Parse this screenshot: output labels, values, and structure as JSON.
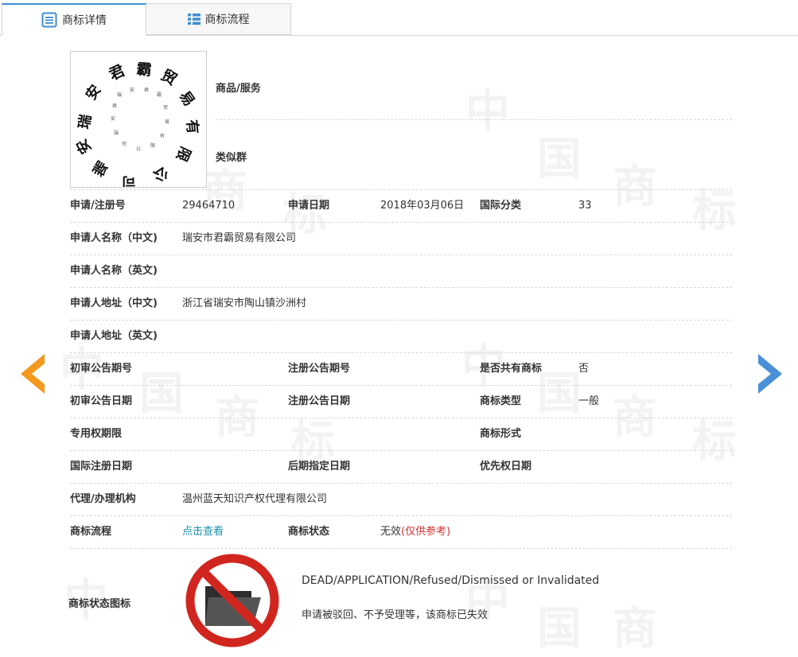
{
  "tabs": [
    {
      "label": "商标详情",
      "active": true,
      "icon": "document-list-icon"
    },
    {
      "label": "商标流程",
      "active": false,
      "icon": "grid-list-icon"
    }
  ],
  "watermark": {
    "chars": [
      "中",
      "国",
      "商",
      "标"
    ]
  },
  "logo": {
    "description_icon": "calligraphy-circular-logo",
    "chars_outer": [
      "端",
      "安",
      "君",
      "霸",
      "贸",
      "易",
      "有",
      "限",
      "公",
      "司",
      "瑞"
    ]
  },
  "goods_services_label": "商品/服务",
  "similar_group_label": "类似群",
  "fields": {
    "reg_no_label": "申请/注册号",
    "reg_no_value": "29464710",
    "app_date_label": "申请日期",
    "app_date_value": "2018年03月06日",
    "intl_class_label": "国际分类",
    "intl_class_value": "33",
    "applicant_cn_label": "申请人名称（中文)",
    "applicant_cn_value": "瑞安市君霸贸易有限公司",
    "applicant_en_label": "申请人名称（英文)",
    "address_cn_label": "申请人地址（中文)",
    "address_cn_value": "浙江省瑞安市陶山镇沙洲村",
    "address_en_label": "申请人地址（英文)",
    "prelim_no_label": "初审公告期号",
    "reg_notice_no_label": "注册公告期号",
    "shared_label": "是否共有商标",
    "shared_value": "否",
    "prelim_date_label": "初审公告日期",
    "reg_notice_date_label": "注册公告日期",
    "type_label": "商标类型",
    "type_value": "一般",
    "exclusive_term_label": "专用权期限",
    "form_label": "商标形式",
    "intl_reg_date_label": "国际注册日期",
    "later_designation_label": "后期指定日期",
    "priority_date_label": "优先权日期",
    "agent_label": "代理/办理机构",
    "agent_value": "温州蓝天知识产权代理有限公司",
    "process_label": "商标流程",
    "process_link": "点击查看",
    "status_label": "商标状态",
    "status_value": "无效",
    "status_ref": "(仅供参考)",
    "status_icon_label": "商标状态图标",
    "status_en": "DEAD/APPLICATION/Refused/Dismissed or Invalidated",
    "status_zh": "申请被驳回、不予受理等，该商标已失效"
  },
  "nav": {
    "prev_icon": "chevron-left-icon",
    "next_icon": "chevron-right-icon"
  },
  "colors": {
    "accent": "#3e8ed0",
    "prev_arrow": "#f39a1e",
    "next_arrow": "#4a90d9",
    "link": "#1a8fb0",
    "ref": "#d0302e",
    "no_sign": "#d1261f"
  }
}
